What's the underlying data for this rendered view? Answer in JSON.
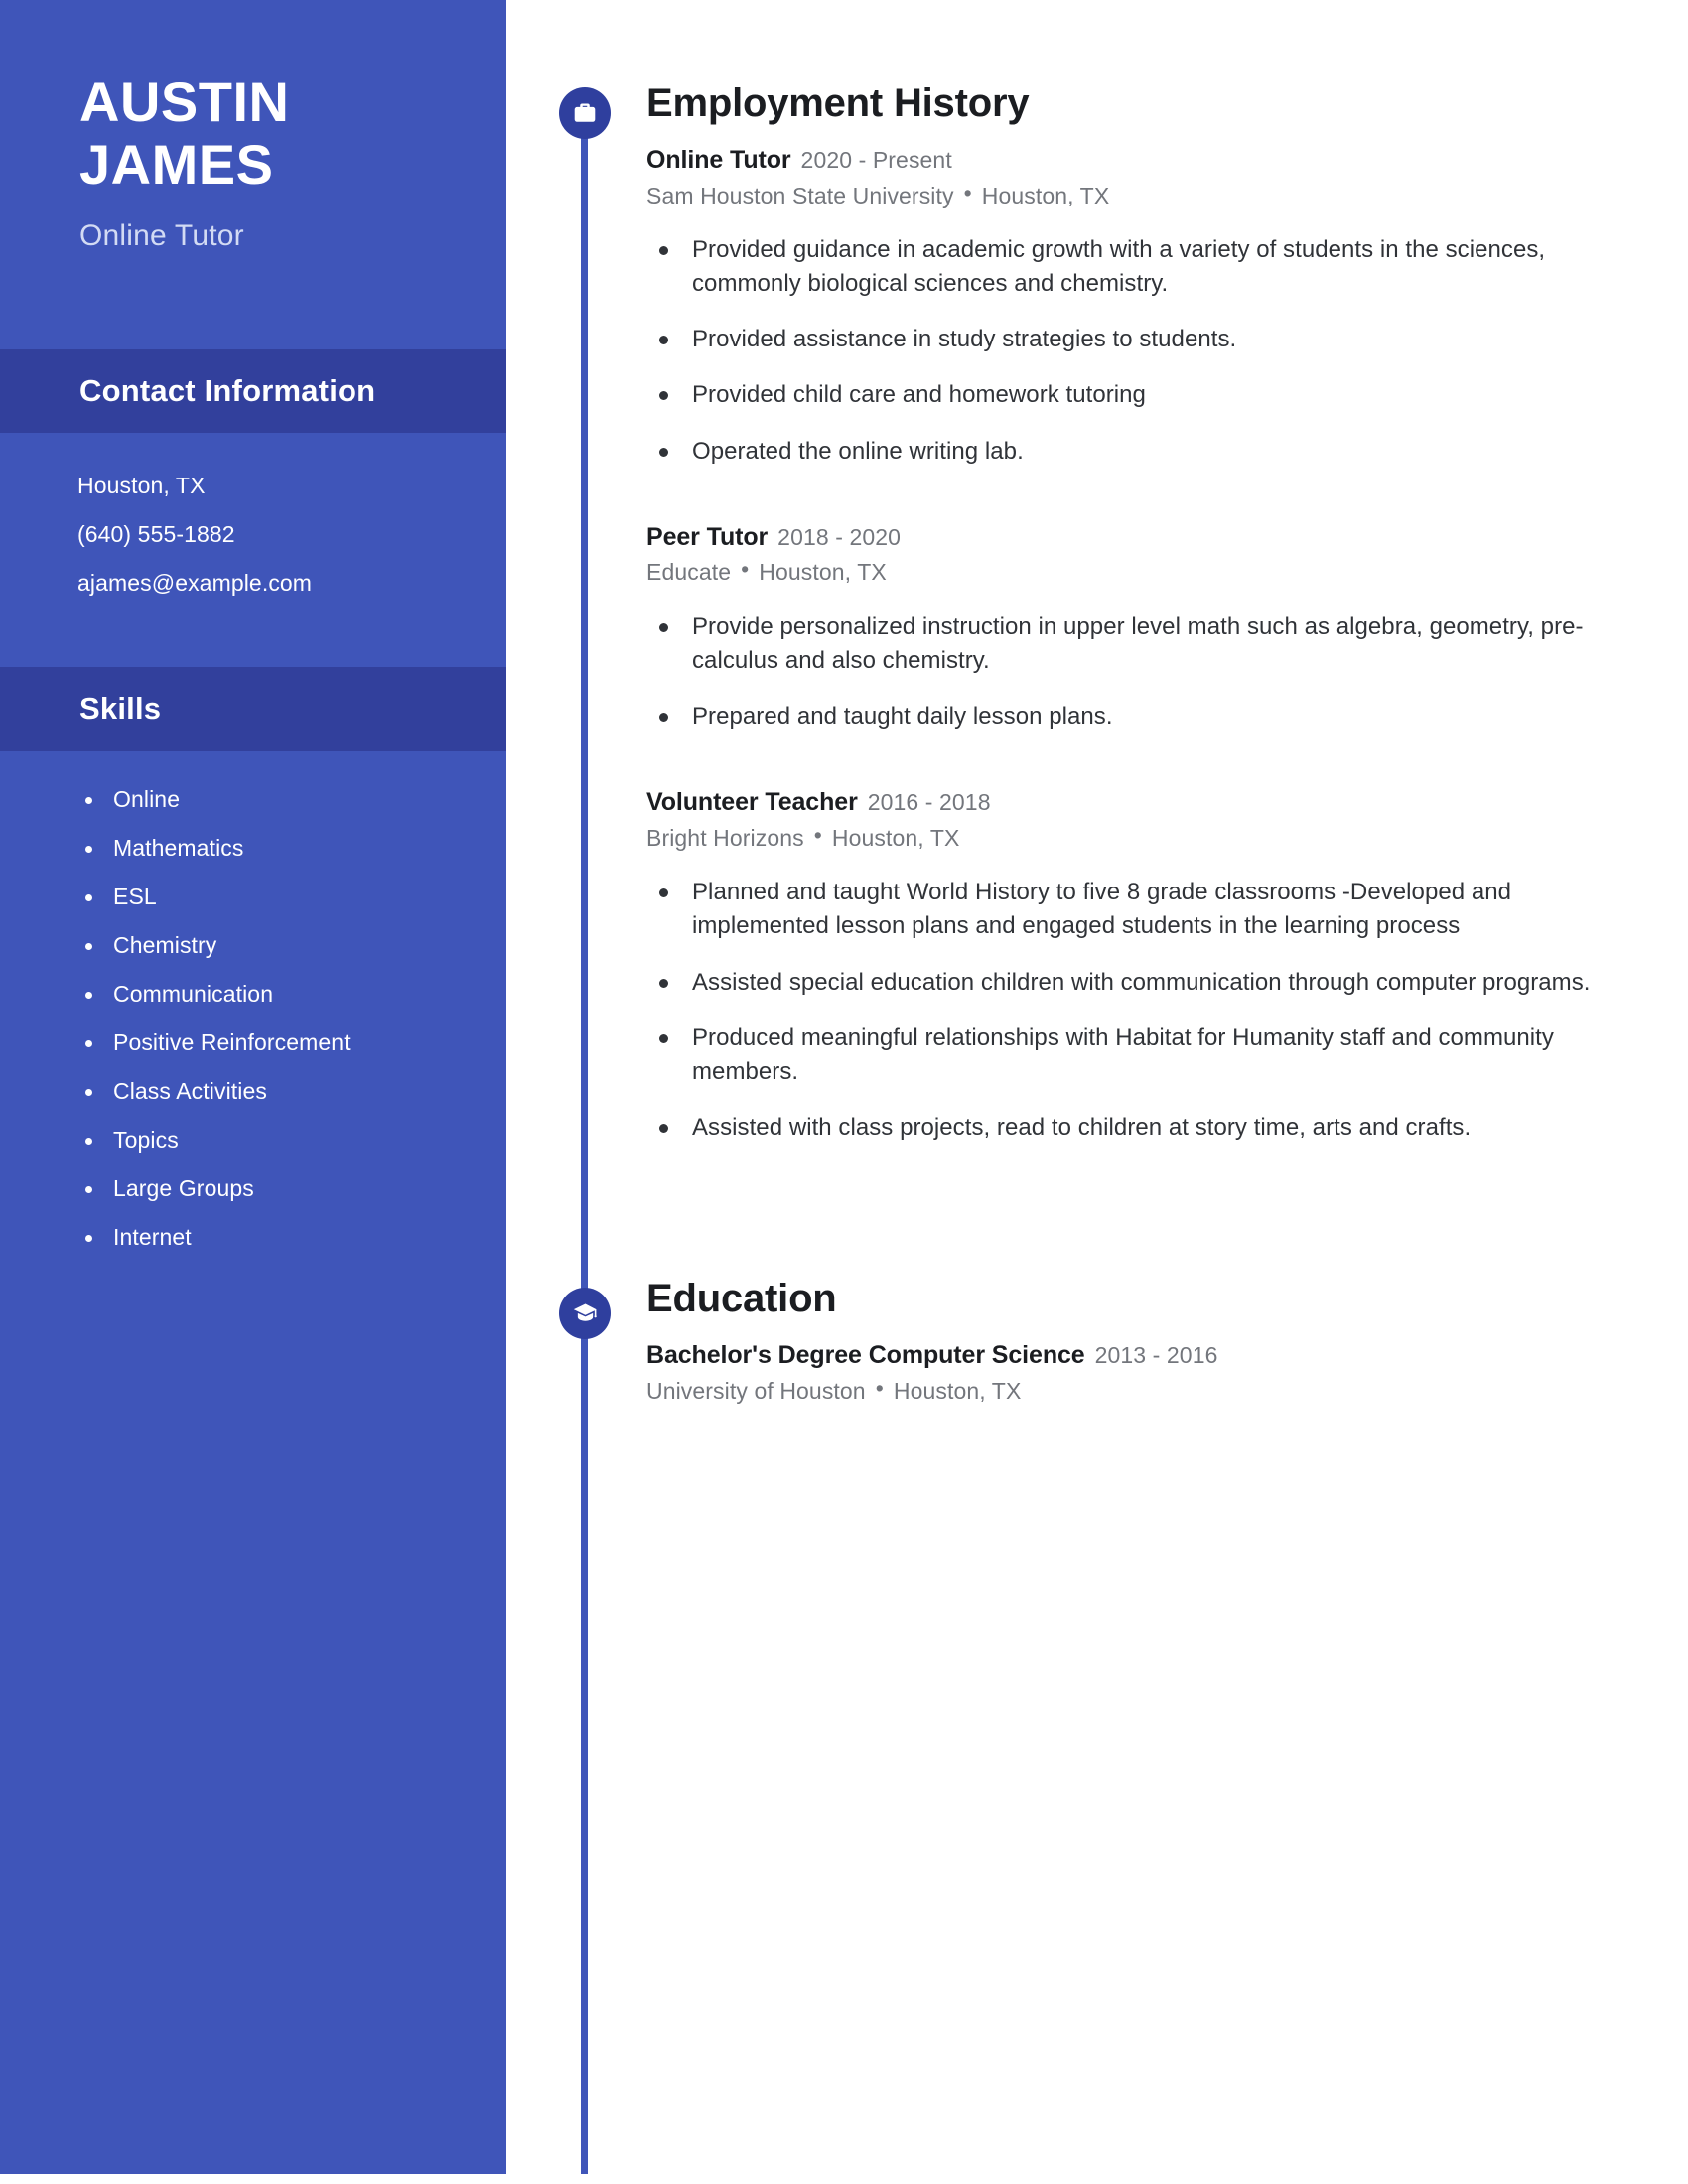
{
  "sidebar": {
    "name_lines": [
      "AUSTIN",
      "JAMES"
    ],
    "job_title": "Online Tutor",
    "contact": {
      "heading": "Contact Information",
      "lines": [
        "Houston, TX",
        "(640) 555-1882",
        "ajames@example.com"
      ]
    },
    "skills": {
      "heading": "Skills",
      "items": [
        "Online",
        "Mathematics",
        "ESL",
        "Chemistry",
        "Communication",
        "Positive Reinforcement",
        "Class Activities",
        "Topics",
        "Large Groups",
        "Internet"
      ]
    }
  },
  "main": {
    "employment": {
      "title": "Employment History",
      "icon": "briefcase-icon",
      "entries": [
        {
          "role": "Online Tutor",
          "dates": "2020 - Present",
          "organization": "Sam Houston State University",
          "location": "Houston, TX",
          "separator": "•",
          "bullets": [
            "Provided guidance in academic growth with a variety of students in the sciences, commonly biological sciences and chemistry.",
            "Provided assistance in study strategies to students.",
            "Provided child care and homework tutoring",
            "Operated the online writing lab."
          ]
        },
        {
          "role": "Peer Tutor",
          "dates": "2018 - 2020",
          "organization": "Educate",
          "location": "Houston, TX",
          "separator": "•",
          "bullets": [
            "Provide personalized instruction in upper level math such as algebra, geometry, pre-calculus and also chemistry.",
            "Prepared and taught daily lesson plans."
          ]
        },
        {
          "role": "Volunteer Teacher",
          "dates": "2016 - 2018",
          "organization": "Bright Horizons",
          "location": "Houston, TX",
          "separator": "•",
          "bullets": [
            "Planned and taught World History to five 8 grade classrooms -Developed and implemented lesson plans and engaged students in the learning process",
            "Assisted special education children with communication through computer programs.",
            "Produced meaningful relationships with Habitat for Humanity staff and community members.",
            "Assisted with class projects, read to children at story time, arts and crafts."
          ]
        }
      ]
    },
    "education": {
      "title": "Education",
      "icon": "graduation-cap-icon",
      "entries": [
        {
          "role": "Bachelor's Degree Computer Science",
          "dates": "2013 - 2016",
          "organization": "University of Houston",
          "location": "Houston, TX",
          "separator": "•",
          "bullets": []
        }
      ]
    }
  },
  "colors": {
    "sidebar_bg": "#3f55b9",
    "sidebar_header_bg": "#32409c",
    "timeline_node_bg": "#2f3f9e",
    "timeline_rail": "#3f55b9",
    "heading_text": "#1b1d21",
    "body_text": "#303338",
    "muted_text": "#73767c",
    "sidebar_subtitle": "#d3dbf4"
  }
}
